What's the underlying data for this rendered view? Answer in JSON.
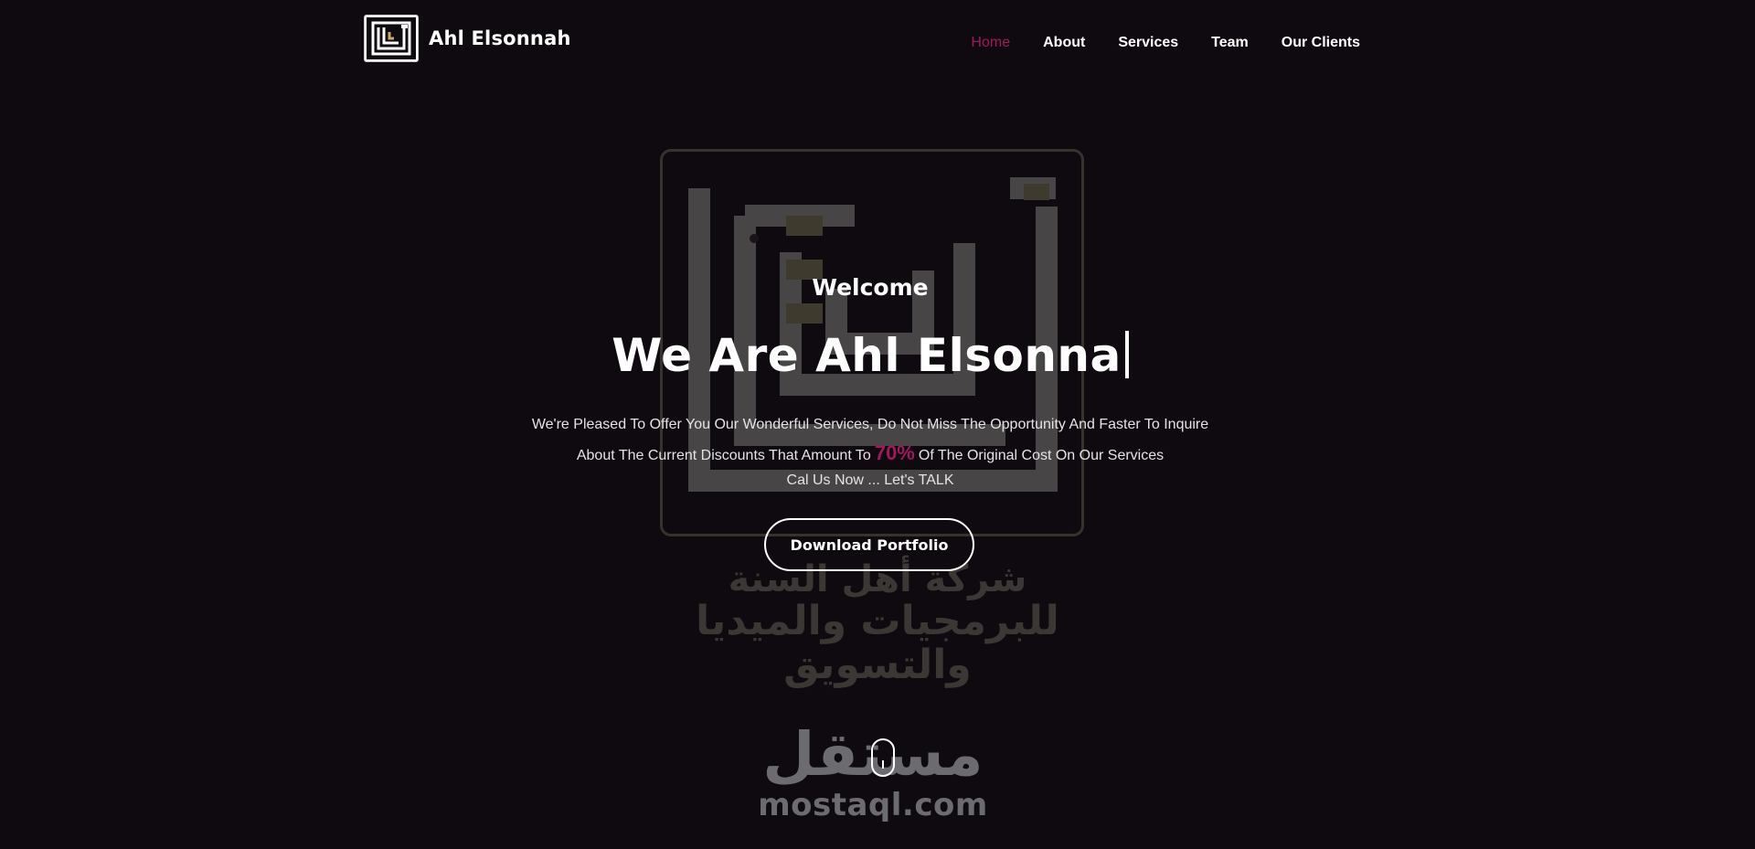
{
  "header": {
    "brand_name": "Ahl Elsonnah",
    "logo_icon": "ahl-elsonnah-calligraphy-logo"
  },
  "nav": {
    "items": [
      {
        "label": "Home",
        "active": true
      },
      {
        "label": "About",
        "active": false
      },
      {
        "label": "Services",
        "active": false
      },
      {
        "label": "Team",
        "active": false
      },
      {
        "label": "Our Clients",
        "active": false
      }
    ]
  },
  "hero": {
    "welcome": "Welcome",
    "headline": "We Are Ahl Elsonna",
    "tagline_line1": "We're Pleased To Offer You Our Wonderful Services, Do Not Miss The Opportunity And Faster To Inquire",
    "tagline_line2_before": "About The Current Discounts That Amount To",
    "discount": "70%",
    "tagline_line2_after": "Of The Original Cost On Our Services",
    "tagline_line3": "Cal Us Now ... Let's TALK",
    "download_button": "Download Portfolio",
    "background_logo_line1": "شركة أهل السنة",
    "background_logo_line2": "للبرمجيات والميديا والتسويق"
  },
  "watermark": {
    "arabic": "مستقل",
    "latin": "mostaql.com"
  },
  "colors": {
    "background": "#0f0a10",
    "accent": "#a0195c",
    "text": "#ffffff"
  }
}
